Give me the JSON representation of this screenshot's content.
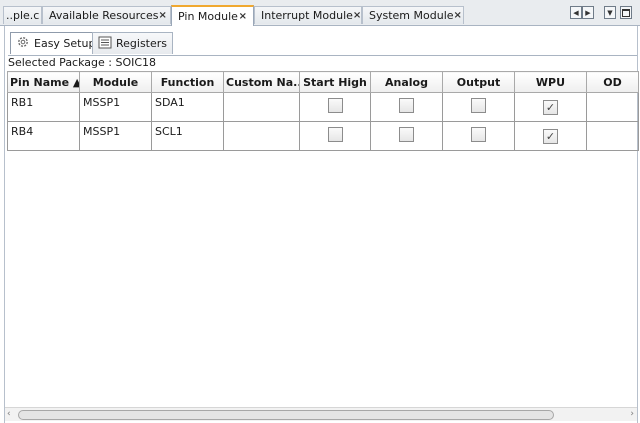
{
  "tabs": [
    {
      "label": "..ple.c",
      "closable": false
    },
    {
      "label": "Available Resources",
      "closable": true
    },
    {
      "label": "Pin Module",
      "closable": true,
      "active": true
    },
    {
      "label": "Interrupt Module",
      "closable": true
    },
    {
      "label": "System Module",
      "closable": true
    }
  ],
  "close_glyph": "×",
  "subtabs": {
    "easy_setup": "Easy Setup",
    "registers": "Registers"
  },
  "package": "Selected Package : SOIC18",
  "columns": [
    "Pin Name ▲",
    "Module",
    "Function",
    "Custom Na...",
    "Start High",
    "Analog",
    "Output",
    "WPU",
    "OD"
  ],
  "rows": [
    {
      "pin": "RB1",
      "module": "MSSP1",
      "function": "SDA1",
      "custom": "",
      "start_high": false,
      "analog": false,
      "output": false,
      "wpu": true
    },
    {
      "pin": "RB4",
      "module": "MSSP1",
      "function": "SCL1",
      "custom": "",
      "start_high": false,
      "analog": false,
      "output": false,
      "wpu": true
    }
  ],
  "check_glyph": "✓",
  "icons": {
    "easy_setup": "gear-icon",
    "registers": "register-list-icon",
    "nav": [
      "scroll-left-icon",
      "scroll-right-icon",
      "tab-list-dropdown-icon",
      "maximize-window-icon"
    ]
  },
  "accent": "#f0a830"
}
